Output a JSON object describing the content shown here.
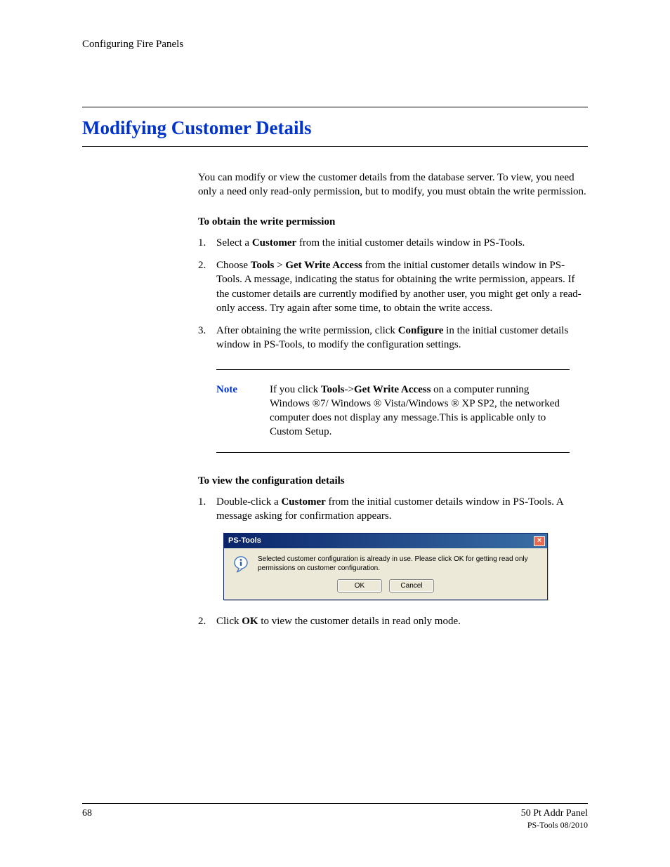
{
  "header": {
    "section": "Configuring Fire Panels"
  },
  "title": "Modifying Customer Details",
  "intro": "You can modify or view the customer details from the database server. To view, you need only a need only read-only permission, but to modify, you must obtain the write permission.",
  "sub1": "To obtain the write permission",
  "steps_a": {
    "s1_pre": "Select a ",
    "s1_b": "Customer",
    "s1_post": " from the initial customer details window in PS-Tools.",
    "s2_pre": "Choose ",
    "s2_b1": "Tools",
    "s2_mid1": " > ",
    "s2_b2": "Get Write Access",
    "s2_post": " from the initial customer details window in PS-Tools. A message, indicating the status for obtaining the write permission, appears. If the customer details are currently modified by another user, you might get only a read-only access. Try again after some time, to obtain the write access.",
    "s3_pre": "After obtaining the write permission, click ",
    "s3_b": "Configure",
    "s3_post": " in the initial customer details window in PS-Tools, to modify the configuration settings."
  },
  "note": {
    "label": "Note",
    "pre": "If you click ",
    "b1": "Tools",
    "mid1": "->",
    "b2": "Get Write Access",
    "post": " on a computer running Windows ®7/ Windows ® Vista/Windows ® XP SP2,  the networked computer does not display any message.This is applicable only to Custom Setup."
  },
  "sub2": "To view the configuration details",
  "steps_b": {
    "s1_pre": "Double-click a ",
    "s1_b": "Customer",
    "s1_post": " from the initial customer details window in PS-Tools. A message asking for confirmation appears.",
    "s2_pre": "Click ",
    "s2_b": "OK",
    "s2_post": " to view the customer details in read only mode."
  },
  "dialog": {
    "title": "PS-Tools",
    "message": "Selected customer configuration is already in use. Please click OK for getting read only permissions on customer configuration.",
    "ok": "OK",
    "cancel": "Cancel",
    "close": "×"
  },
  "footer": {
    "page": "68",
    "right1": "50 Pt Addr Panel",
    "right2": "PS-Tools 08/2010"
  },
  "nums": {
    "n1": "1.",
    "n2": "2.",
    "n3": "3."
  }
}
